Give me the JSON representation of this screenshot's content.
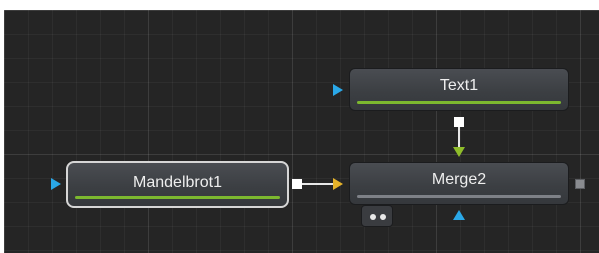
{
  "flow": {
    "nodes": {
      "text1": {
        "title": "Text1",
        "bar_color": "#7cb82f"
      },
      "mandelbrot1": {
        "title": "Mandelbrot1",
        "bar_color": "#7cb82f",
        "selected": true
      },
      "merge2": {
        "title": "Merge2",
        "bar_color": "#7e8187"
      }
    },
    "colors": {
      "background_input": "#2aa8e8",
      "foreground_input": "#e6b32a",
      "mask_input": "#8fbd2a",
      "output": "#ffffff",
      "unconnected_output": "#8a8c90"
    }
  }
}
